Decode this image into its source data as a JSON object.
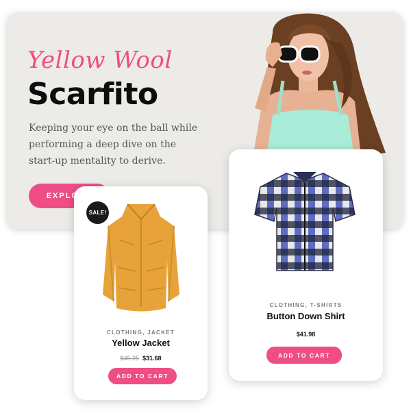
{
  "hero": {
    "script_title": "Yellow Wool",
    "title": "Scarfito",
    "description": "Keeping your eye on the ball while performing a deep dive on the start-up mentality to derive.",
    "explore_label": "EXPLORE"
  },
  "products": [
    {
      "badge": "SALE!",
      "category": "CLOTHING, JACKET",
      "name": "Yellow Jacket",
      "old_price": "$45.25",
      "price": "$31.68",
      "cart_label": "ADD TO CART"
    },
    {
      "category": "CLOTHING, T-SHIRTS",
      "name": "Button Down Shirt",
      "price": "$41.98",
      "cart_label": "ADD TO CART"
    }
  ],
  "colors": {
    "accent": "#ef4d86",
    "hero_bg": "#ecebe8",
    "text_dark": "#111111"
  }
}
